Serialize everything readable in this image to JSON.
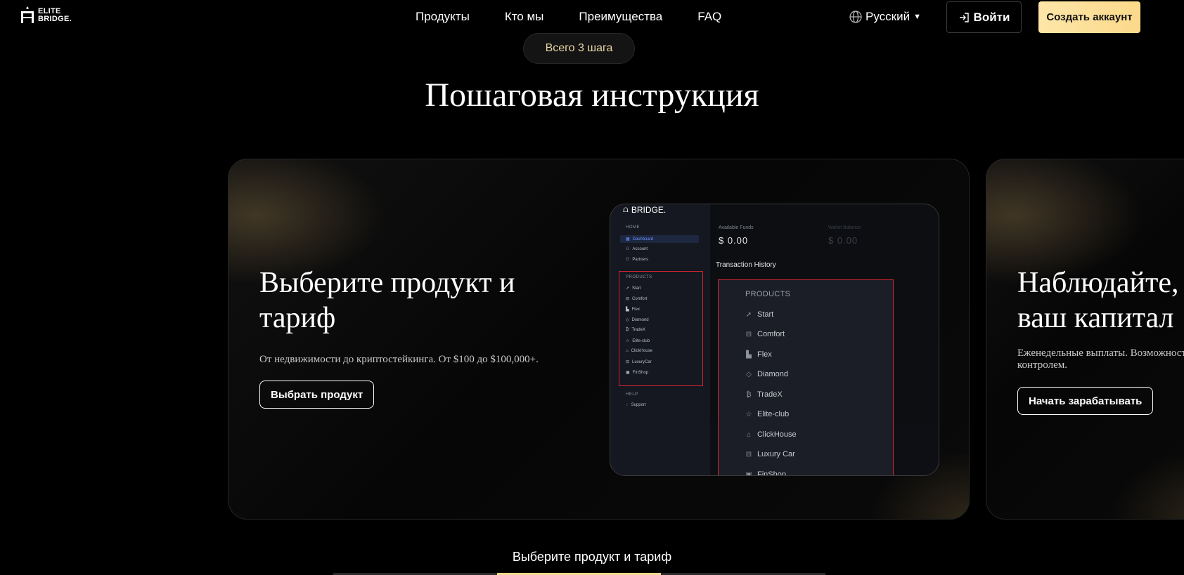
{
  "header": {
    "logo_line1": "ELITE",
    "logo_line2": "BRIDGE.",
    "nav": [
      "Продукты",
      "Кто мы",
      "Преимущества",
      "FAQ"
    ],
    "language": "Русский",
    "login_label": "Войти",
    "signup_label": "Создать аккаунт"
  },
  "hero": {
    "pill": "Всего 3 шага",
    "title": "Пошаговая инструкция"
  },
  "card1": {
    "title": "Выберите продукт и тариф",
    "description": "От недвижимости до криптостейкинга. От $100 до $100,000+.",
    "button": "Выбрать продукт"
  },
  "card2": {
    "title": "Наблюдайте, ваш капитал",
    "description": "Еженедельные выплаты. Возможность под контролем.",
    "button": "Начать зарабатывать"
  },
  "mockup": {
    "brand": "BRIDGE.",
    "home_section": "HOME",
    "home_items": [
      "Dashboard",
      "Account",
      "Partners"
    ],
    "products_section": "PRODUCTS",
    "products_items": [
      "Start",
      "Comfort",
      "Flex",
      "Diamond",
      "TradeX",
      "Elite-club",
      "ClickHouse",
      "LuxuryCar",
      "FinShop"
    ],
    "help_section": "HELP",
    "help_items": [
      "Support"
    ],
    "available_funds_label": "Available Funds",
    "available_funds_value": "$ 0.00",
    "second_funds_label": "Wallet Balance",
    "second_funds_value": "$ 0.00",
    "transaction_history": "Transaction History",
    "overlay_title": "PRODUCTS",
    "overlay_items": [
      "Start",
      "Comfort",
      "Flex",
      "Diamond",
      "TradeX",
      "Elite-club",
      "ClickHouse",
      "Luxury Car",
      "FinShop"
    ],
    "overlay_icons": [
      "rocket-icon",
      "car-icon",
      "chart-icon",
      "diamond-icon",
      "bitcoin-icon",
      "star-icon",
      "home-icon",
      "car-icon",
      "shop-icon"
    ]
  },
  "footer": {
    "active_step_title": "Выберите продукт и тариф"
  },
  "colors": {
    "accent_gold": "#fbd98a",
    "pill_text": "#e8d6a8",
    "highlight_red": "#d3252f"
  }
}
